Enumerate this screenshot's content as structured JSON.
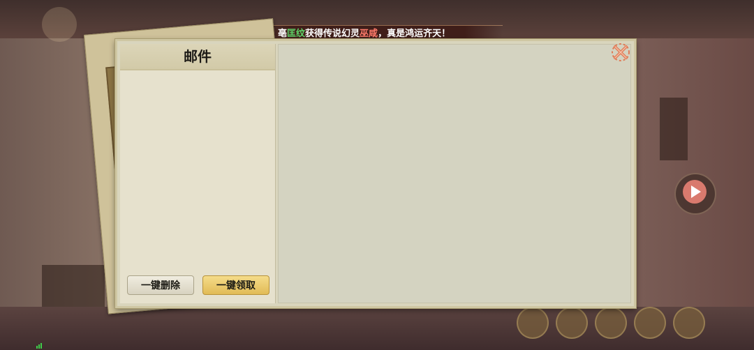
{
  "marquee": {
    "prefix": "亳",
    "player": "匡纹",
    "middle": "获得传说幻灵",
    "item": "巫咸",
    "suffix": "，真是鸿运齐天！"
  },
  "mail_panel": {
    "title": "邮件",
    "delete_all_label": "一键删除",
    "claim_all_label": "一键领取"
  },
  "icons": {
    "close": "close-x-icon",
    "side_button": "play-video-icon",
    "signal": "signal-bars-icon"
  },
  "colors": {
    "panel_bg": "#d9d5bd",
    "claim_button": "#e1bb56",
    "delete_button": "#e6e2d2",
    "close_icon": "#e07a55",
    "marquee_green": "#5fd66a",
    "marquee_red": "#ff7a6a"
  }
}
